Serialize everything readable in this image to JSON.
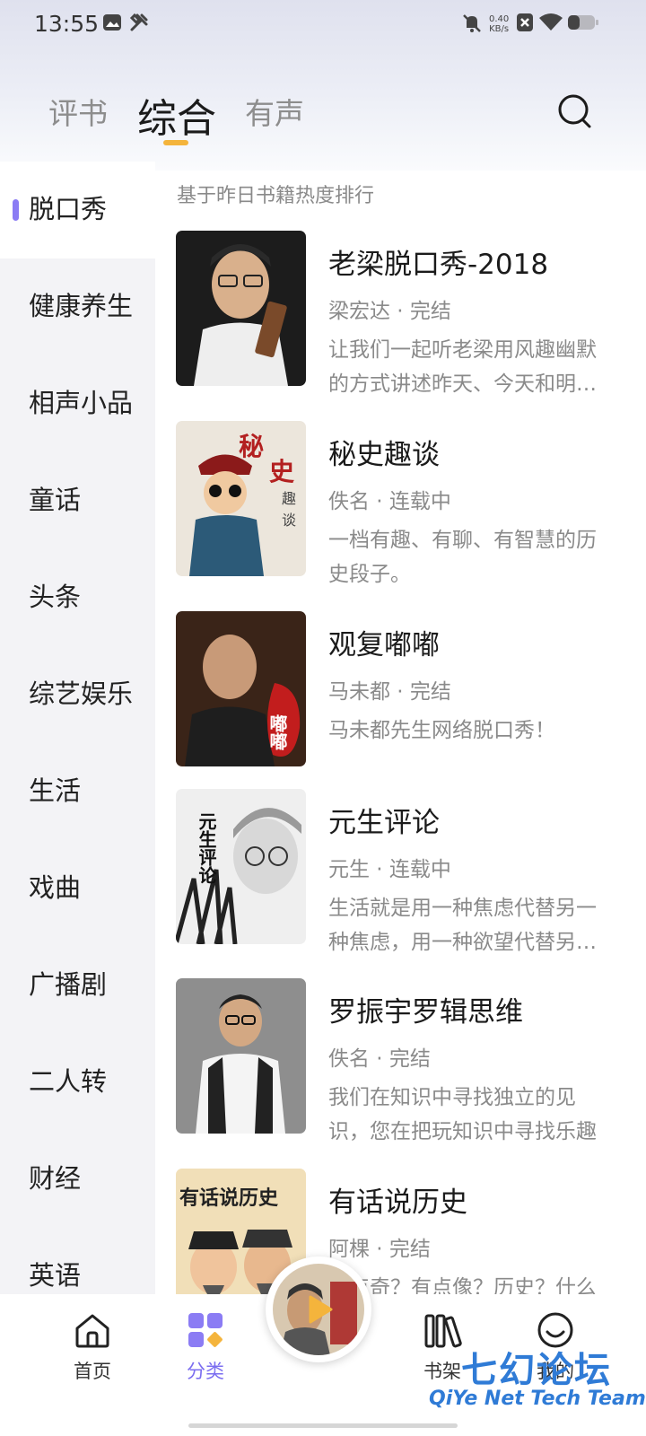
{
  "status_bar": {
    "time": "13:55",
    "net_speed": "0.40",
    "net_unit": "KB/s"
  },
  "tabs": [
    {
      "label": "评书",
      "active": false
    },
    {
      "label": "综合",
      "active": true
    },
    {
      "label": "有声",
      "active": false
    }
  ],
  "accent_color": "#8b7cf4",
  "indicator_color": "#f4b43c",
  "sidebar": {
    "items": [
      {
        "label": "脱口秀",
        "active": true
      },
      {
        "label": "健康养生"
      },
      {
        "label": "相声小品"
      },
      {
        "label": "童话"
      },
      {
        "label": "头条"
      },
      {
        "label": "综艺娱乐"
      },
      {
        "label": "生活"
      },
      {
        "label": "戏曲"
      },
      {
        "label": "广播剧"
      },
      {
        "label": "二人转"
      },
      {
        "label": "财经"
      },
      {
        "label": "英语"
      }
    ]
  },
  "rank_note": "基于昨日书籍热度排行",
  "books": [
    {
      "title": "老梁脱口秀-2018",
      "meta": "梁宏达 · 完结",
      "desc": "让我们一起听老梁用风趣幽默的方式讲述昨天、今天和明天的事情"
    },
    {
      "title": "秘史趣谈",
      "meta": "佚名 · 连载中",
      "desc": "一档有趣、有聊、有智慧的历史段子。",
      "cover_text_1": "秘",
      "cover_text_2": "史",
      "cover_text_3": "趣",
      "cover_text_4": "谈"
    },
    {
      "title": "观复嘟嘟",
      "meta": "马未都 · 完结",
      "desc": "马未都先生网络脱口秀！",
      "cover_text": "嘟嘟"
    },
    {
      "title": "元生评论",
      "meta": "元生 · 连载中",
      "desc": "生活就是用一种焦虑代替另一种焦虑，用一种欲望代替另一种欲望",
      "cover_text": "元生评论"
    },
    {
      "title": "罗振宇罗辑思维",
      "meta": "佚名 · 完结",
      "desc": "我们在知识中寻找独立的见识，您在把玩知识中寻找乐趣"
    },
    {
      "title": "有话说历史",
      "meta": "阿棵 · 完结",
      "desc": "有点奇？有点像？历史？什么",
      "cover_text": "有话说历史"
    }
  ],
  "bottom_nav": {
    "items": [
      {
        "label": "首页",
        "icon": "home-icon"
      },
      {
        "label": "分类",
        "icon": "category-icon",
        "active": true
      },
      {
        "label": "书架",
        "icon": "bookshelf-icon"
      },
      {
        "label": "我的",
        "icon": "profile-icon"
      }
    ]
  },
  "watermark": {
    "cn": "七幻论坛",
    "en": "QiYe Net Tech Team"
  }
}
